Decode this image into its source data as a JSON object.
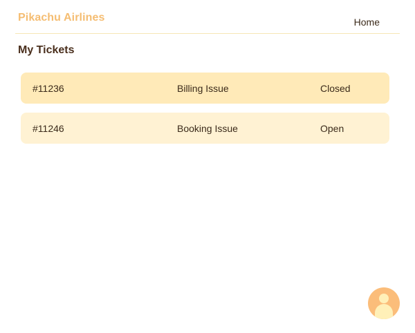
{
  "header": {
    "brand": "Pikachu Airlines",
    "nav": [
      {
        "label": "Home"
      }
    ]
  },
  "page": {
    "title": "My Tickets"
  },
  "tickets": [
    {
      "id": "#11236",
      "subject": "Billing Issue",
      "status": "Closed"
    },
    {
      "id": "#11246",
      "subject": "Booking Issue",
      "status": "Open"
    }
  ],
  "colors": {
    "brand": "#f5bd72",
    "row_closed": "#ffeab8",
    "row_open": "#fff2d3",
    "avatar": "#fbbd7a"
  },
  "icons": {
    "avatar": "user-avatar-icon"
  }
}
